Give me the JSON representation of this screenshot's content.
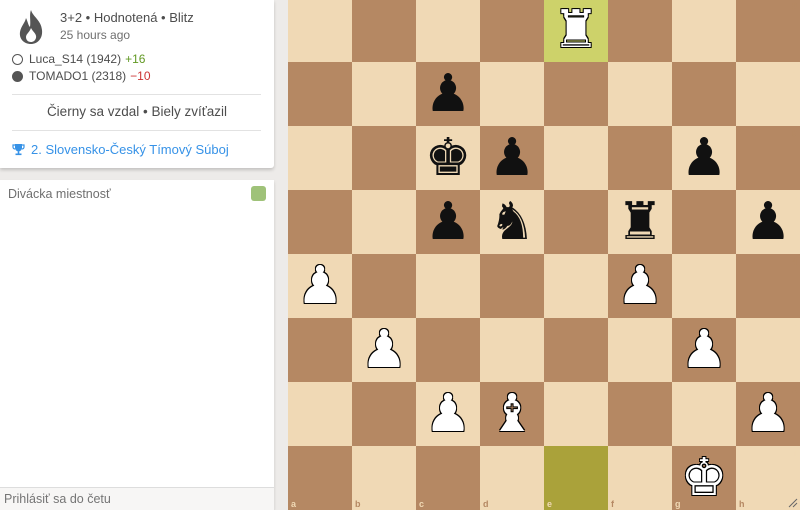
{
  "game": {
    "meta": "3+2 • Hodnotená • Blitz",
    "time_ago": "25 hours ago",
    "white": {
      "name": "Luca_S14 (1942)",
      "diff": "+16"
    },
    "black": {
      "name": "TOMADO1 (2318)",
      "diff": "−10"
    },
    "result": "Čierny sa vzdal • Biely zvíťazil",
    "tournament": "2. Slovensko-Český Tímový Súboj"
  },
  "chat": {
    "title": "Divácka miestnosť",
    "placeholder": "Prihlásiť sa do četu"
  },
  "board": {
    "files": [
      "a",
      "b",
      "c",
      "d",
      "e",
      "f",
      "g",
      "h"
    ],
    "ranks": [
      "8",
      "7",
      "6",
      "5",
      "4",
      "3",
      "2",
      "1"
    ],
    "highlight": [
      "e8",
      "e1"
    ],
    "pieces": [
      {
        "sq": "e8",
        "color": "w",
        "type": "rook"
      },
      {
        "sq": "c7",
        "color": "b",
        "type": "pawn"
      },
      {
        "sq": "c6",
        "color": "b",
        "type": "king"
      },
      {
        "sq": "d6",
        "color": "b",
        "type": "pawn"
      },
      {
        "sq": "g6",
        "color": "b",
        "type": "pawn"
      },
      {
        "sq": "c5",
        "color": "b",
        "type": "pawn"
      },
      {
        "sq": "d5",
        "color": "b",
        "type": "knight"
      },
      {
        "sq": "f5",
        "color": "b",
        "type": "rook"
      },
      {
        "sq": "h5",
        "color": "b",
        "type": "pawn"
      },
      {
        "sq": "a4",
        "color": "w",
        "type": "pawn"
      },
      {
        "sq": "f4",
        "color": "w",
        "type": "pawn"
      },
      {
        "sq": "b3",
        "color": "w",
        "type": "pawn"
      },
      {
        "sq": "g3",
        "color": "w",
        "type": "pawn"
      },
      {
        "sq": "c2",
        "color": "w",
        "type": "pawn"
      },
      {
        "sq": "d2",
        "color": "w",
        "type": "bishop"
      },
      {
        "sq": "h2",
        "color": "w",
        "type": "pawn"
      },
      {
        "sq": "g1",
        "color": "w",
        "type": "king"
      }
    ]
  },
  "colors": {
    "light": "#f0d9b5",
    "dark": "#b58863",
    "highlight": "#cdd26a",
    "accent": "#3692e7",
    "win": "#629924",
    "loss": "#cc3333"
  }
}
